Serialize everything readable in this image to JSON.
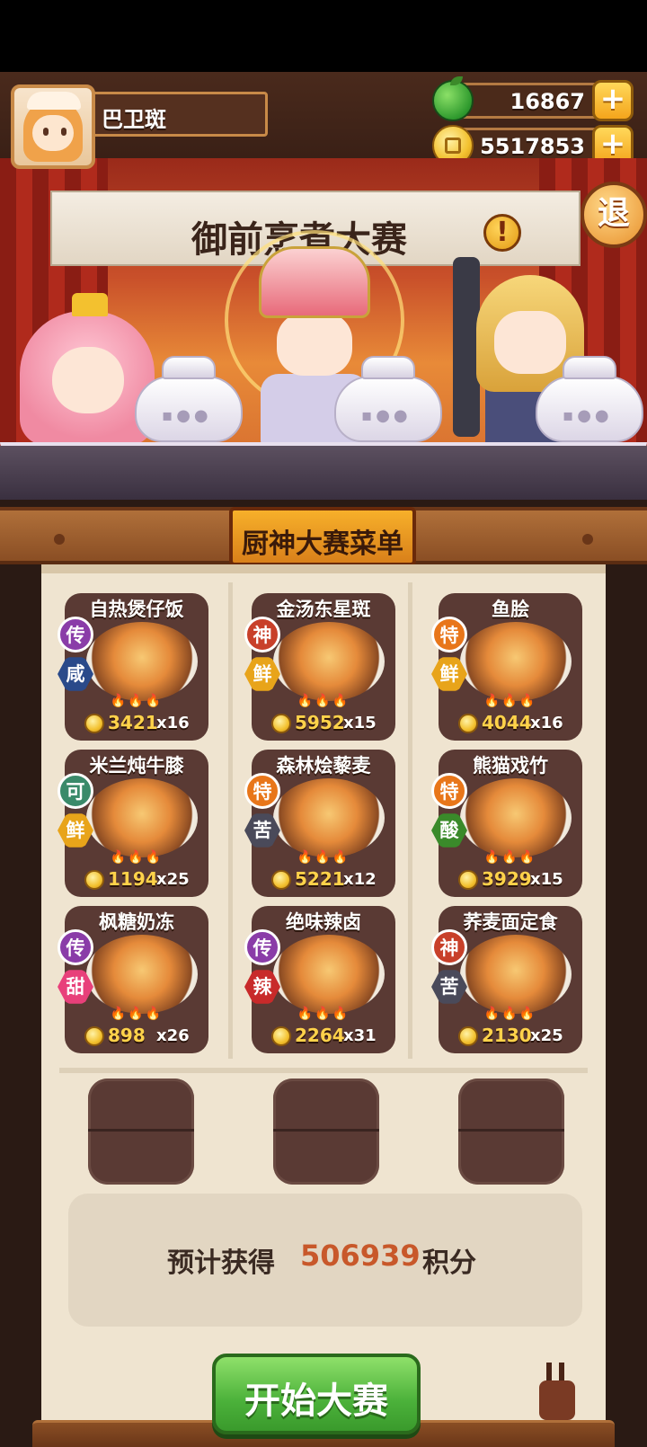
{
  "player": {
    "name": "巴卫斑"
  },
  "resources": {
    "apples": "16867",
    "coins": "5517853"
  },
  "banner": {
    "title": "御前烹煮大赛",
    "exit_label": "退"
  },
  "menu": {
    "title": "厨神大赛菜单",
    "dishes": [
      {
        "name": "自热煲仔饭",
        "rank": "传",
        "flavor": "咸",
        "price": "3421",
        "count": "x16",
        "rank_color": "#8a3ca8",
        "flavor_color": "#2a4a8a"
      },
      {
        "name": "金汤东星斑",
        "rank": "神",
        "flavor": "鲜",
        "price": "5952",
        "count": "x15",
        "rank_color": "#c8402a",
        "flavor_color": "#e8a41a"
      },
      {
        "name": "鱼脍",
        "rank": "特",
        "flavor": "鲜",
        "price": "4044",
        "count": "x16",
        "rank_color": "#e8761a",
        "flavor_color": "#e8a41a"
      },
      {
        "name": "米兰炖牛膝",
        "rank": "可",
        "flavor": "鲜",
        "price": "1194",
        "count": "x25",
        "rank_color": "#3a8a6a",
        "flavor_color": "#e8a41a"
      },
      {
        "name": "森林烩藜麦",
        "rank": "特",
        "flavor": "苦",
        "price": "5221",
        "count": "x12",
        "rank_color": "#e8761a",
        "flavor_color": "#4a4a5a"
      },
      {
        "name": "熊猫戏竹",
        "rank": "特",
        "flavor": "酸",
        "price": "3929",
        "count": "x15",
        "rank_color": "#e8761a",
        "flavor_color": "#3a8a2a"
      },
      {
        "name": "枫糖奶冻",
        "rank": "传",
        "flavor": "甜",
        "price": "898",
        "count": "x26",
        "rank_color": "#8a3ca8",
        "flavor_color": "#e8407a"
      },
      {
        "name": "绝味辣卤",
        "rank": "传",
        "flavor": "辣",
        "price": "2264",
        "count": "x31",
        "rank_color": "#8a3ca8",
        "flavor_color": "#c82a2a"
      },
      {
        "name": "荞麦面定食",
        "rank": "神",
        "flavor": "苦",
        "price": "2130",
        "count": "x25",
        "rank_color": "#c8402a",
        "flavor_color": "#4a4a5a"
      }
    ]
  },
  "estimate": {
    "prefix": "预计获得",
    "value": "506939",
    "suffix": "积分"
  },
  "start_button": {
    "label": "开始大赛"
  },
  "icons": {
    "apple": "apple-icon",
    "coin": "coin-icon",
    "plus": "plus-icon",
    "alert": "exclamation-icon",
    "flame": "flame-icon"
  },
  "colors": {
    "price": "#ffd24a",
    "estimate_value": "#c8582a",
    "start_button": "#4bb13a",
    "menu_plate": "#f7b02a"
  }
}
